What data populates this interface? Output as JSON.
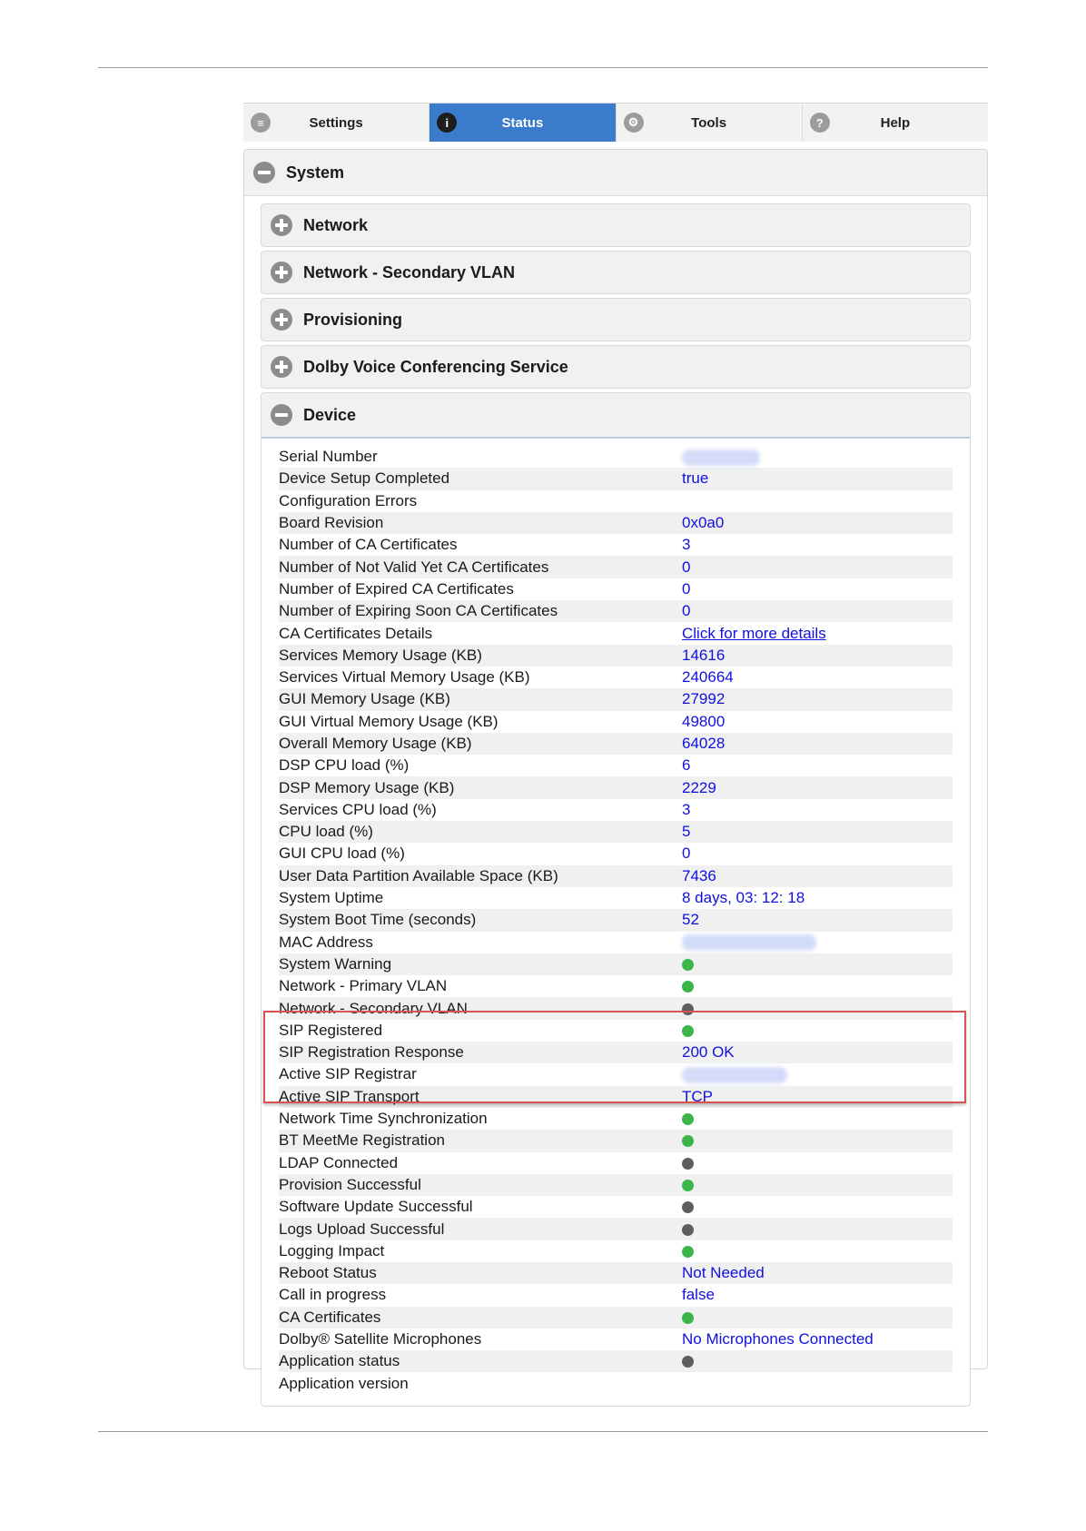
{
  "tabs": [
    {
      "label": "Settings",
      "icon": "list-icon"
    },
    {
      "label": "Status",
      "icon": "info-icon"
    },
    {
      "label": "Tools",
      "icon": "gear-icon"
    },
    {
      "label": "Help",
      "icon": "help-icon"
    }
  ],
  "active_tab": "Status",
  "system": {
    "title": "System",
    "sections": [
      "Network",
      "Network - Secondary VLAN",
      "Provisioning",
      "Dolby Voice Conferencing Service"
    ],
    "device": {
      "title": "Device",
      "rows": [
        {
          "label": "Serial Number",
          "type": "redacted",
          "value": ""
        },
        {
          "label": "Device Setup Completed",
          "type": "text",
          "value": "true"
        },
        {
          "label": "Configuration Errors",
          "type": "text",
          "value": ""
        },
        {
          "label": "Board Revision",
          "type": "text",
          "value": "0x0a0"
        },
        {
          "label": "Number of CA Certificates",
          "type": "text",
          "value": "3"
        },
        {
          "label": "Number of Not Valid Yet CA Certificates",
          "type": "text",
          "value": "0"
        },
        {
          "label": "Number of Expired CA Certificates",
          "type": "text",
          "value": "0"
        },
        {
          "label": "Number of Expiring Soon CA Certificates",
          "type": "text",
          "value": "0"
        },
        {
          "label": "CA Certificates Details",
          "type": "link",
          "value": "Click for more details"
        },
        {
          "label": "Services Memory Usage (KB)",
          "type": "text",
          "value": "14616"
        },
        {
          "label": "Services Virtual Memory Usage (KB)",
          "type": "text",
          "value": "240664"
        },
        {
          "label": "GUI Memory Usage (KB)",
          "type": "text",
          "value": "27992"
        },
        {
          "label": "GUI Virtual Memory Usage (KB)",
          "type": "text",
          "value": "49800"
        },
        {
          "label": "Overall Memory Usage (KB)",
          "type": "text",
          "value": "64028"
        },
        {
          "label": "DSP CPU load (%)",
          "type": "text",
          "value": "6"
        },
        {
          "label": "DSP Memory Usage (KB)",
          "type": "text",
          "value": "2229"
        },
        {
          "label": "Services CPU load (%)",
          "type": "text",
          "value": "3"
        },
        {
          "label": "CPU load (%)",
          "type": "text",
          "value": "5"
        },
        {
          "label": "GUI CPU load (%)",
          "type": "text",
          "value": "0"
        },
        {
          "label": "User Data Partition Available Space (KB)",
          "type": "text",
          "value": "7436"
        },
        {
          "label": "System Uptime",
          "type": "text",
          "value": "8 days, 03: 12: 18"
        },
        {
          "label": "System Boot Time (seconds)",
          "type": "text",
          "value": "52"
        },
        {
          "label": "MAC Address",
          "type": "redacted",
          "value": ""
        },
        {
          "label": "System Warning",
          "type": "status",
          "value": "green"
        },
        {
          "label": "Network - Primary VLAN",
          "type": "status",
          "value": "green"
        },
        {
          "label": "Network - Secondary VLAN",
          "type": "status",
          "value": "gray"
        },
        {
          "label": "SIP Registered",
          "type": "status",
          "value": "green"
        },
        {
          "label": "SIP Registration Response",
          "type": "text",
          "value": "200 OK"
        },
        {
          "label": "Active SIP Registrar",
          "type": "redacted",
          "value": ""
        },
        {
          "label": "Active SIP Transport",
          "type": "text",
          "value": "TCP"
        },
        {
          "label": "Network Time Synchronization",
          "type": "status",
          "value": "green"
        },
        {
          "label": "BT MeetMe Registration",
          "type": "status",
          "value": "green"
        },
        {
          "label": "LDAP Connected",
          "type": "status",
          "value": "gray"
        },
        {
          "label": "Provision Successful",
          "type": "status",
          "value": "green"
        },
        {
          "label": "Software Update Successful",
          "type": "status",
          "value": "gray"
        },
        {
          "label": "Logs Upload Successful",
          "type": "status",
          "value": "gray"
        },
        {
          "label": "Logging Impact",
          "type": "status",
          "value": "green"
        },
        {
          "label": "Reboot Status",
          "type": "text",
          "value": "Not Needed"
        },
        {
          "label": "Call in progress",
          "type": "text",
          "value": "false"
        },
        {
          "label": "CA Certificates",
          "type": "status",
          "value": "green"
        },
        {
          "label": "Dolby® Satellite Microphones",
          "type": "text",
          "value": "No Microphones Connected"
        },
        {
          "label": "Application status",
          "type": "status",
          "value": "gray"
        },
        {
          "label": "Application version",
          "type": "text",
          "value": ""
        }
      ]
    }
  },
  "highlighted_rows": [
    "SIP Registered",
    "SIP Registration Response",
    "Active SIP Registrar",
    "Active SIP Transport"
  ],
  "colors": {
    "accent": "#3a7bcc",
    "value_text": "#1010e0",
    "status_ok": "#39b54a",
    "status_off": "#5e5e5e",
    "highlight_border": "#d9534f"
  }
}
